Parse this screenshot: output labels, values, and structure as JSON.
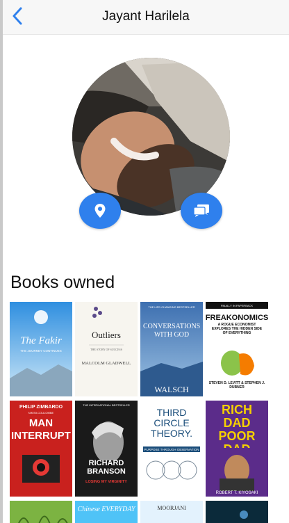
{
  "header": {
    "title": "Jayant Harilela",
    "accent": "#2f80ed"
  },
  "profile": {
    "actions": {
      "location_icon": "location-pin-icon",
      "message_icon": "chat-bubbles-icon"
    }
  },
  "books_section": {
    "title": "Books owned",
    "books": [
      {
        "name": "The Fakir",
        "subtitle": "THE JOURNEY CONTINUES"
      },
      {
        "name": "Outliers",
        "subtitle": "THE STORY OF SUCCESS",
        "author": "MALCOLM GLADWELL"
      },
      {
        "name": "CONVERSATIONS WITH GOD",
        "tagline": "THE LIFE-CHANGING BESTSELLER",
        "author": "WALSCH"
      },
      {
        "name": "FREAKONOMICS",
        "tagline": "FINALLY IN PAPERBACK",
        "subtitle": "A ROGUE ECONOMIST EXPLORES THE HIDDEN SIDE OF EVERYTHING",
        "author": "STEVEN D. LEVITT & STEPHEN J. DUBNER"
      },
      {
        "name": "MAN INTERRUPTED",
        "author": "PHILIP ZIMBARDO",
        "coauthor": "NIKITA COULOMBE"
      },
      {
        "name": "RICHARD BRANSON",
        "tagline": "THE INTERNATIONAL BESTSELLER",
        "subtitle": "LOSING MY VIRGINITY"
      },
      {
        "name": "THIRD CIRCLE THEORY.",
        "subtitle": "PURPOSE THROUGH OBSERVATION"
      },
      {
        "name": "RICH DAD POOR DAD",
        "author": "ROBERT T. KIYOSAKI"
      },
      {
        "name": ""
      },
      {
        "name": "Chinese EVERYDAY"
      },
      {
        "name": "MOORJANI"
      },
      {
        "name": ""
      }
    ]
  }
}
